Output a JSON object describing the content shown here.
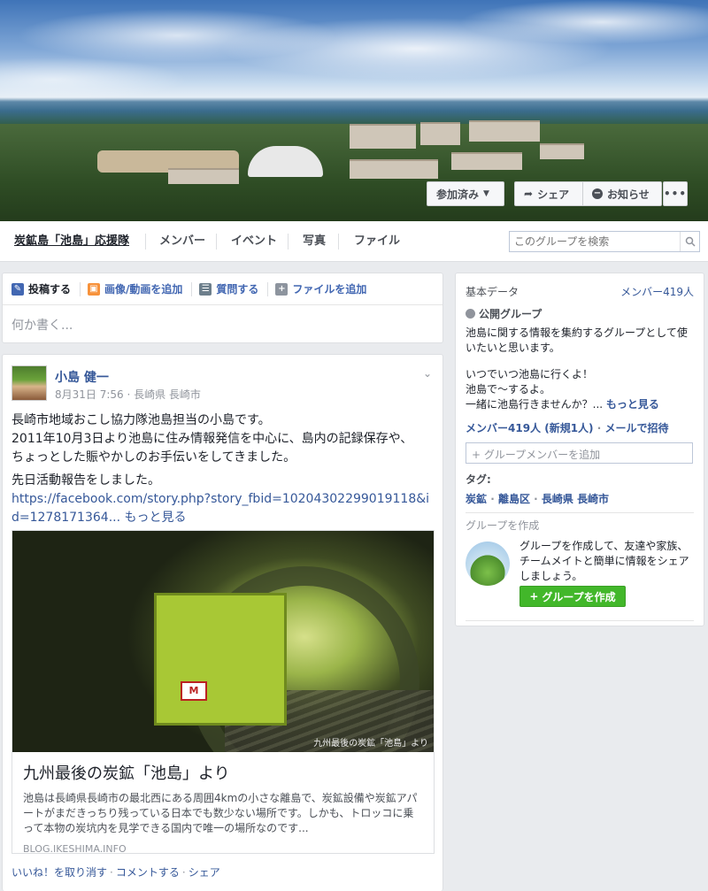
{
  "cover": {
    "joined_label": "参加済み",
    "share_label": "シェア",
    "notify_label": "お知らせ",
    "more_label": "•••"
  },
  "nav": {
    "group_name": "炭鉱島「池島」応援隊",
    "members": "メンバー",
    "events": "イベント",
    "photos": "写真",
    "files": "ファイル",
    "search_placeholder": "このグループを検索"
  },
  "composer": {
    "tabs": [
      "投稿する",
      "画像/動画を追加",
      "質問する",
      "ファイルを追加"
    ],
    "placeholder": "何か書く..."
  },
  "post": {
    "author": "小島 健一",
    "meta": "8月31日 7:56 · 長崎県 長崎市",
    "lines": [
      "長崎市地域おこし協力隊池島担当の小島です。",
      "2011年10月3日より池島に住み情報発信を中心に、島内の記録保存や、",
      "ちょっとした賑やかしのお手伝いをしてきました。",
      "先日活動報告をしました。"
    ],
    "url": "https://facebook.com/story.php?story_fbid=10204302299019118&id=1278171364...",
    "see_more": "もっと見る",
    "link": {
      "image_caption": "九州最後の炭鉱「池島」より",
      "title": "九州最後の炭鉱「池島」より",
      "description": "池島は長崎県長崎市の最北西にある周囲4kmの小さな離島で、炭鉱設備や炭鉱アパートがまだきっちり残っている日本でも数少ない場所です。しかも、トロッコに乗って本物の炭坑内を見学できる国内で唯一の場所なのです...",
      "domain": "BLOG.IKESHIMA.INFO"
    },
    "actions": [
      "いいね！を取り消す",
      "コメントする",
      "シェア"
    ]
  },
  "sidebar": {
    "heading": "基本データ",
    "member_count": "メンバー419人",
    "privacy": "公開グループ",
    "description": "池島に関する情報を集約するグループとして使いたいと思います。",
    "desc2_lines": [
      "いつでいつ池島に行くよ！",
      "池島で〜するよ。",
      "一緒に池島行きませんか？..."
    ],
    "see_more": "もっと見る",
    "members_new": "メンバー419人 (新規1人)",
    "invite_email": "メールで招待",
    "add_member_placeholder": "+ グループメンバーを追加",
    "tags_label": "タグ:",
    "tags": [
      "炭鉱",
      "離島区",
      "長崎県 長崎市"
    ],
    "create_heading": "グループを作成",
    "create_text": "グループを作成して、友達や家族、チームメイトと簡単に情報をシェアしましょう。",
    "create_button": "グループを作成"
  }
}
